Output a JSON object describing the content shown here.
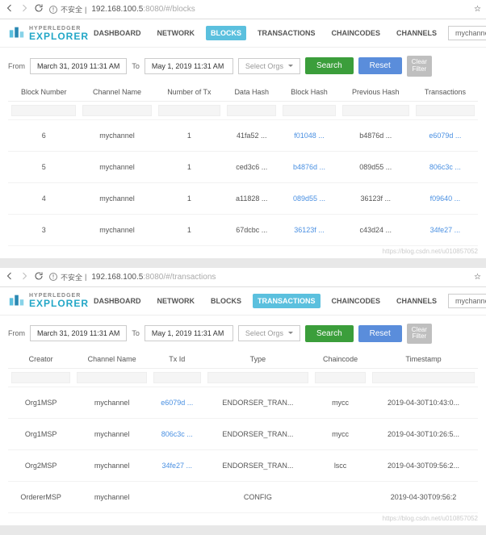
{
  "addr1": {
    "insecure": "不安全",
    "ip": "192.168.100.5",
    "port": ":8080",
    "path": "/#/blocks"
  },
  "addr2": {
    "insecure": "不安全",
    "ip": "192.168.100.5",
    "port": ":8080",
    "path": "/#/transactions"
  },
  "logo": {
    "top": "HYPERLEDGER",
    "bot": "EXPLORER"
  },
  "nav": [
    "DASHBOARD",
    "NETWORK",
    "BLOCKS",
    "TRANSACTIONS",
    "CHAINCODES",
    "CHANNELS"
  ],
  "channel": "mychannel",
  "filters": {
    "from": "From",
    "to": "To",
    "d1": "March 31, 2019 11:31 AM",
    "d2": "May 1, 2019 11:31 AM",
    "orgsel": "Select Orgs",
    "search": "Search",
    "reset": "Reset",
    "clear1": "Clear",
    "clear2": "Filter"
  },
  "blocksHead": [
    "Block Number",
    "Channel Name",
    "Number of Tx",
    "Data Hash",
    "Block Hash",
    "Previous Hash",
    "Transactions"
  ],
  "blocks": [
    {
      "num": "6",
      "ch": "mychannel",
      "tx": "1",
      "data": "41fa52 ...",
      "block": "f01048 ...",
      "prev": "b4876d ...",
      "trans": "e6079d ..."
    },
    {
      "num": "5",
      "ch": "mychannel",
      "tx": "1",
      "data": "ced3c6 ...",
      "block": "b4876d ...",
      "prev": "089d55 ...",
      "trans": "806c3c ..."
    },
    {
      "num": "4",
      "ch": "mychannel",
      "tx": "1",
      "data": "a11828 ...",
      "block": "089d55 ...",
      "prev": "36123f ...",
      "trans": "f09640 ..."
    },
    {
      "num": "3",
      "ch": "mychannel",
      "tx": "1",
      "data": "67dcbc ...",
      "block": "36123f ...",
      "prev": "c43d24 ...",
      "trans": "34fe27 ..."
    }
  ],
  "txHead": [
    "Creator",
    "Channel Name",
    "Tx Id",
    "Type",
    "Chaincode",
    "Timestamp"
  ],
  "txs": [
    {
      "creator": "Org1MSP",
      "ch": "mychannel",
      "txid": "e6079d ...",
      "type": "ENDORSER_TRAN...",
      "cc": "mycc",
      "ts": "2019-04-30T10:43:0..."
    },
    {
      "creator": "Org1MSP",
      "ch": "mychannel",
      "txid": "806c3c ...",
      "type": "ENDORSER_TRAN...",
      "cc": "mycc",
      "ts": "2019-04-30T10:26:5..."
    },
    {
      "creator": "Org2MSP",
      "ch": "mychannel",
      "txid": "34fe27 ...",
      "type": "ENDORSER_TRAN...",
      "cc": "lscc",
      "ts": "2019-04-30T09:56:2..."
    },
    {
      "creator": "OrdererMSP",
      "ch": "mychannel",
      "txid": "",
      "type": "CONFIG",
      "cc": "",
      "ts": "2019-04-30T09:56:2"
    }
  ],
  "wmark": "https://blog.csdn.net/u010857052"
}
